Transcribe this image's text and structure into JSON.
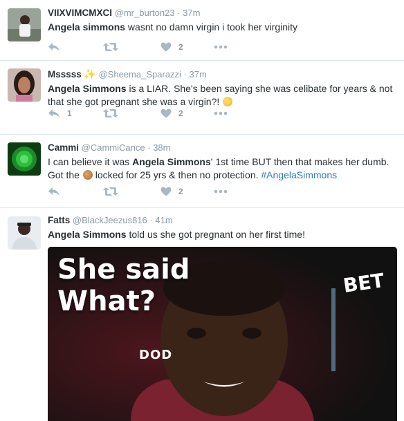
{
  "colors": {
    "text": "#292f33",
    "muted": "#8899a6",
    "action_icon": "#aab8c2",
    "hashtag": "#2b7bb9",
    "divider": "#e1e8ed"
  },
  "tweets": [
    {
      "name": "VIIXVIMCMXCI",
      "handle": "@mr_burton23",
      "time": "37m",
      "text_bold": "Angela simmons",
      "text_rest": " wasnt no damn virgin i took her virginity",
      "reply_count": "",
      "like_count": "2"
    },
    {
      "name": "Msssss",
      "handle_icon": "sparkles-icon",
      "handle": "@Sheema_Sparazzi",
      "time": "37m",
      "text_bold": "Angela Simmons",
      "text_rest": " is a LIAR. She's been saying she was celibate for years & not that she got pregnant she was a virgin?!",
      "emoji": "thinking-face-icon",
      "reply_count": "1",
      "like_count": "2"
    },
    {
      "name": "Cammi",
      "handle": "@CammiCance",
      "time": "38m",
      "text_pre": "I can believe it was ",
      "text_bold": "Angela Simmons",
      "text_mid": "' 1st time BUT then that makes her dumb. Got the ",
      "emoji": "cookie-icon",
      "text_post": " locked for 25 yrs & then no protection. ",
      "hashtag": "#AngelaSimmons",
      "reply_count": "",
      "like_count": "2"
    },
    {
      "name": "Fatts",
      "handle": "@BlackJeezus816",
      "time": "41m",
      "text_bold": "Angela Simmons",
      "text_rest": " told us she got pregnant on her first time!",
      "media": {
        "caption": "She said\nWhat?",
        "logo": "BET",
        "sign": "DOD"
      }
    }
  ],
  "ui": {
    "separator": "·"
  }
}
